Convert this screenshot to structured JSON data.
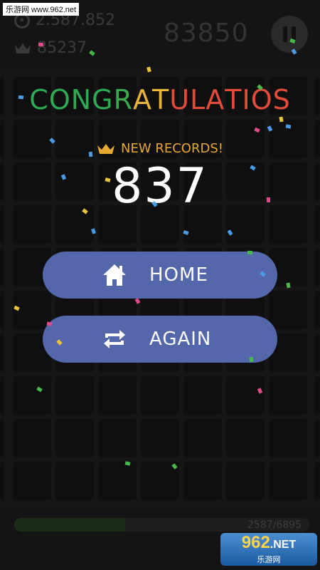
{
  "watermark_top": "乐游网 www.962.net",
  "header": {
    "coins": "2.587.852",
    "best": "85237",
    "score": "83850"
  },
  "overlay": {
    "title_letters": [
      {
        "ch": "C",
        "color": "#2faa54"
      },
      {
        "ch": "O",
        "color": "#2faa54"
      },
      {
        "ch": "N",
        "color": "#2faa54"
      },
      {
        "ch": "G",
        "color": "#2faa54"
      },
      {
        "ch": "R",
        "color": "#3ba84f"
      },
      {
        "ch": "A",
        "color": "#e8b43a"
      },
      {
        "ch": "T",
        "color": "#e8b43a"
      },
      {
        "ch": "U",
        "color": "#e34c3b"
      },
      {
        "ch": "L",
        "color": "#e34c3b"
      },
      {
        "ch": "A",
        "color": "#e34c3b"
      },
      {
        "ch": "T",
        "color": "#e34c3b"
      },
      {
        "ch": "I",
        "color": "#e34c3b"
      },
      {
        "ch": "O",
        "color": "#e34c3b"
      },
      {
        "ch": "S",
        "color": "#e34c3b"
      }
    ],
    "records_label": "NEW RECORDS!",
    "score_value": "837",
    "home_label": "HOME",
    "again_label": "AGAIN"
  },
  "progress": {
    "text": "2587/6895",
    "fraction": 0.375
  },
  "logo": {
    "number": "962",
    "suffix": ".NET",
    "subtitle": "乐游网"
  },
  "colors": {
    "accent_button": "#5467aa",
    "record_gold": "#e7a834"
  },
  "icons": {
    "coin": "coin-icon",
    "crown": "crown-icon",
    "pause": "pause-icon",
    "home": "home-icon",
    "again": "repeat-icon"
  }
}
